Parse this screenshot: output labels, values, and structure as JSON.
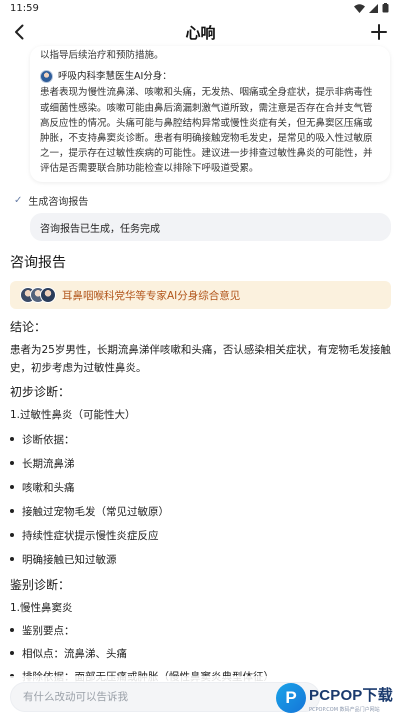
{
  "status_bar": {
    "time": "11:59"
  },
  "nav": {
    "title": "心响"
  },
  "chat": {
    "top_line": "以指导后续治疗和预防措施。",
    "doctor_name": "呼吸内科李慧医生AI分身：",
    "doctor_text": "患者表现为慢性流鼻涕、咳嗽和头痛，无发热、咽痛或全身症状，提示非病毒性或细菌性感染。咳嗽可能由鼻后滴漏刺激气道所致，需注意是否存在合并支气管高反应性的情况。头痛可能与鼻腔结构异常或慢性炎症有关，但无鼻窦区压痛或肿胀，不支持鼻窦炎诊断。患者有明确接触宠物毛发史，是常见的吸入性过敏原之一，提示存在过敏性疾病的可能性。建议进一步排查过敏性鼻炎的可能性，并评估是否需要联合肺功能检查以排除下呼吸道受累。"
  },
  "step": {
    "label": "生成咨询报告",
    "result": "咨询报告已生成，任务完成"
  },
  "report": {
    "title": "咨询报告",
    "expert_banner": "耳鼻咽喉科党华等专家AI分身综合意见",
    "conclusion_heading": "结论：",
    "conclusion_text": "患者为25岁男性，长期流鼻涕伴咳嗽和头痛，否认感染相关症状，有宠物毛发接触史，初步考虑为过敏性鼻炎。",
    "prelim_heading": "初步诊断：",
    "prelim_item": "1.过敏性鼻炎（可能性大）",
    "prelim_bullets": [
      "诊断依据：",
      "长期流鼻涕",
      "咳嗽和头痛",
      "接触过宠物毛发（常见过敏原）",
      "持续性症状提示慢性炎症反应",
      "明确接触已知过敏源"
    ],
    "diff_heading": "鉴别诊断：",
    "diff_item": "1.慢性鼻窦炎",
    "diff_bullets": [
      "鉴别要点：",
      "相似点：流鼻涕、头痛",
      "排除依据：面部无压痛或肿胀（慢性鼻窦炎典型体征）"
    ]
  },
  "input": {
    "placeholder": "有什么改动可以告诉我"
  },
  "watermark": {
    "brand": "PCPOP下载",
    "sub": "PCPOP.COM 数码产品门户网站",
    "icon_letter": "P"
  },
  "colors": {
    "expert_text": "#b2561c",
    "expert_bg": "#fbf1de",
    "result_bg": "#f2f3f6"
  }
}
